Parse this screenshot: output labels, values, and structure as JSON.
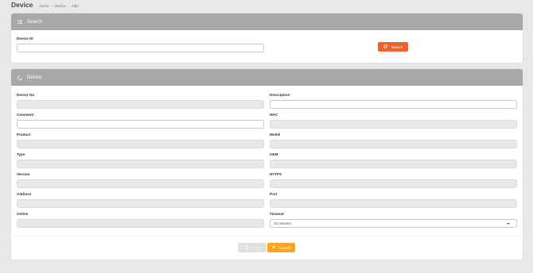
{
  "page": {
    "title": "Device",
    "breadcrumb": [
      "Home",
      "Device",
      "Add"
    ]
  },
  "search_panel": {
    "title": "Search",
    "device_id_label": "Device ID",
    "device_id_value": "",
    "search_button": "Search"
  },
  "device_panel": {
    "title": "Device",
    "fields": {
      "device_no": {
        "label": "Device No",
        "value": ""
      },
      "description": {
        "label": "Description",
        "value": ""
      },
      "comment": {
        "label": "Comment",
        "value": ""
      },
      "mac": {
        "label": "MAC",
        "value": ""
      },
      "product": {
        "label": "Product",
        "value": ""
      },
      "model": {
        "label": "Model",
        "value": ""
      },
      "type": {
        "label": "Type",
        "value": ""
      },
      "oem": {
        "label": "OEM",
        "value": ""
      },
      "version": {
        "label": "Version",
        "value": ""
      },
      "https": {
        "label": "HTTPS",
        "value": ""
      },
      "address": {
        "label": "Address",
        "value": ""
      },
      "port": {
        "label": "Port",
        "value": ""
      },
      "online": {
        "label": "Online",
        "value": ""
      },
      "timeout": {
        "label": "Timeout",
        "value": "15 minutes"
      }
    },
    "save_button": "Save",
    "cancel_button": "Cancel"
  },
  "colors": {
    "panel_header": "#a8a8a8",
    "search_button": "#f0602a",
    "cancel_button": "#f5a623",
    "readonly_field": "#e8e8e8"
  }
}
